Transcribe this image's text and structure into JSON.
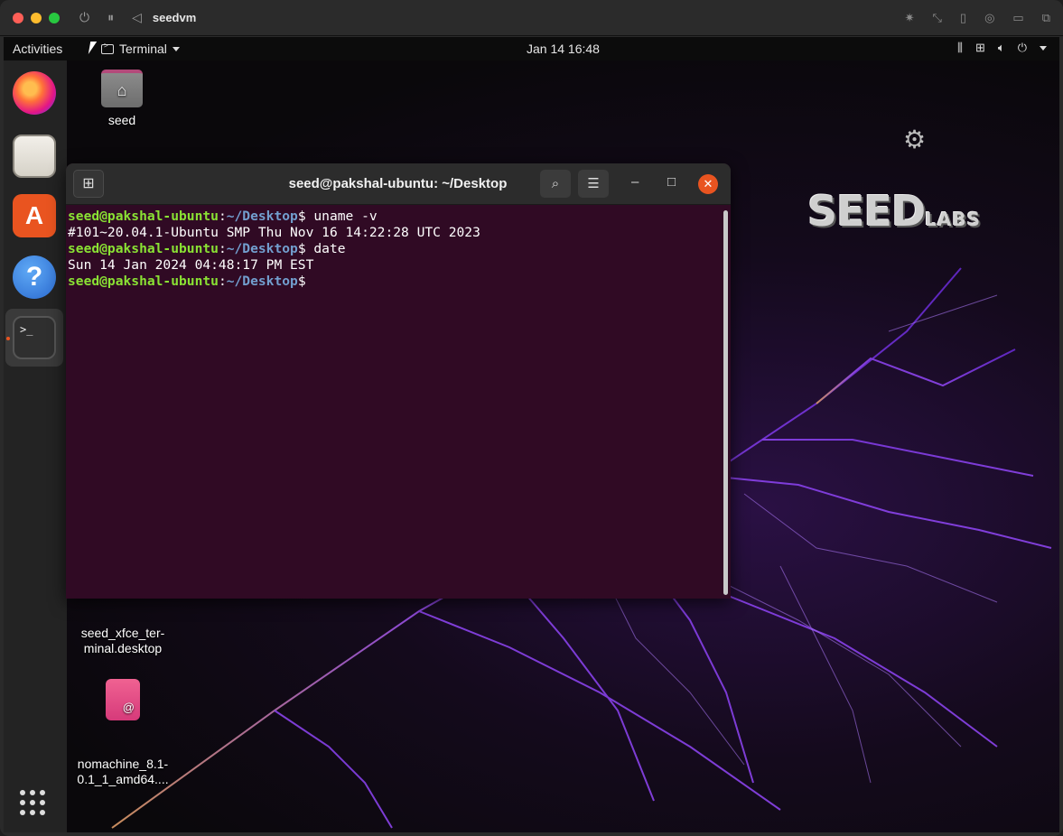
{
  "vm": {
    "title": "seedvm",
    "controls": [
      "power-icon",
      "pause-icon",
      "back-icon"
    ],
    "right_icons": [
      "brightness-icon",
      "resize-icon",
      "usb-icon",
      "network-icon",
      "folder-icon",
      "window-icon"
    ]
  },
  "topbar": {
    "activities": "Activities",
    "app_name": "Terminal",
    "clock": "Jan 14  16:48"
  },
  "dock": {
    "items": [
      "Firefox",
      "Files",
      "Ubuntu Software",
      "Help",
      "Terminal"
    ]
  },
  "desktop": {
    "icons": [
      {
        "label": "seed"
      },
      {
        "label": "seed_xfce_ter-\nminal.desktop"
      },
      {
        "label": "nomachine_8.1-\n0.1_1_amd64...."
      }
    ],
    "logo_main": "SEED",
    "logo_sub": "LABS"
  },
  "terminal": {
    "title": "seed@pakshal-ubuntu: ~/Desktop",
    "prompt_user": "seed@pakshal-ubuntu",
    "prompt_path": "~/Desktop",
    "lines": [
      {
        "type": "prompt",
        "cmd": " uname -v"
      },
      {
        "type": "output",
        "text": "#101~20.04.1-Ubuntu SMP Thu Nov 16 14:22:28 UTC 2023"
      },
      {
        "type": "prompt",
        "cmd": " date"
      },
      {
        "type": "output",
        "text": "Sun 14 Jan 2024 04:48:17 PM EST"
      },
      {
        "type": "prompt",
        "cmd": ""
      }
    ]
  },
  "colors": {
    "terminal_bg": "#300a24",
    "prompt_user": "#8ae234",
    "prompt_path": "#729fcf",
    "ubuntu_orange": "#e95420"
  }
}
